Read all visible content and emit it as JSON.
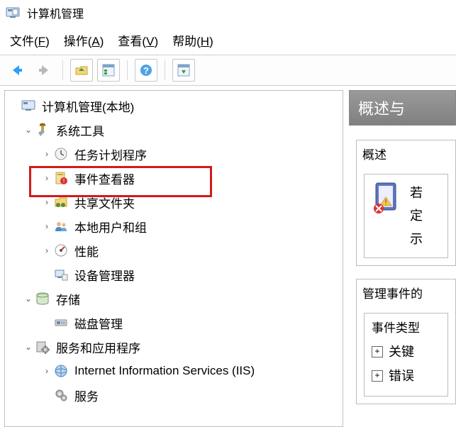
{
  "titlebar": {
    "title": "计算机管理"
  },
  "menubar": {
    "file": {
      "label": "文件",
      "hotkey": "F"
    },
    "action": {
      "label": "操作",
      "hotkey": "A"
    },
    "view": {
      "label": "查看",
      "hotkey": "V"
    },
    "help": {
      "label": "帮助",
      "hotkey": "H"
    }
  },
  "toolbar": {
    "back": "后退",
    "forward": "前进",
    "up": "向上",
    "properties": "属性",
    "help": "帮助",
    "show_hide": "显示/隐藏"
  },
  "tree": {
    "root": {
      "label": "计算机管理(本地)"
    },
    "system_tools": {
      "label": "系统工具",
      "children": {
        "task_scheduler": "任务计划程序",
        "event_viewer": "事件查看器",
        "shared_folders": "共享文件夹",
        "local_users": "本地用户和组",
        "performance": "性能",
        "device_manager": "设备管理器"
      }
    },
    "storage": {
      "label": "存储",
      "children": {
        "disk_mgmt": "磁盘管理"
      }
    },
    "services_apps": {
      "label": "服务和应用程序",
      "children": {
        "iis": "Internet Information Services (IIS)",
        "services": "服务"
      }
    }
  },
  "right": {
    "header": "概述与",
    "overview_title": "概述",
    "overview_text_l1": "若",
    "overview_text_l2": "定",
    "overview_text_l3": "示",
    "manage_events_title": "管理事件的",
    "event_types_title": "事件类型",
    "event_critical": "关键",
    "event_error": "错误"
  }
}
